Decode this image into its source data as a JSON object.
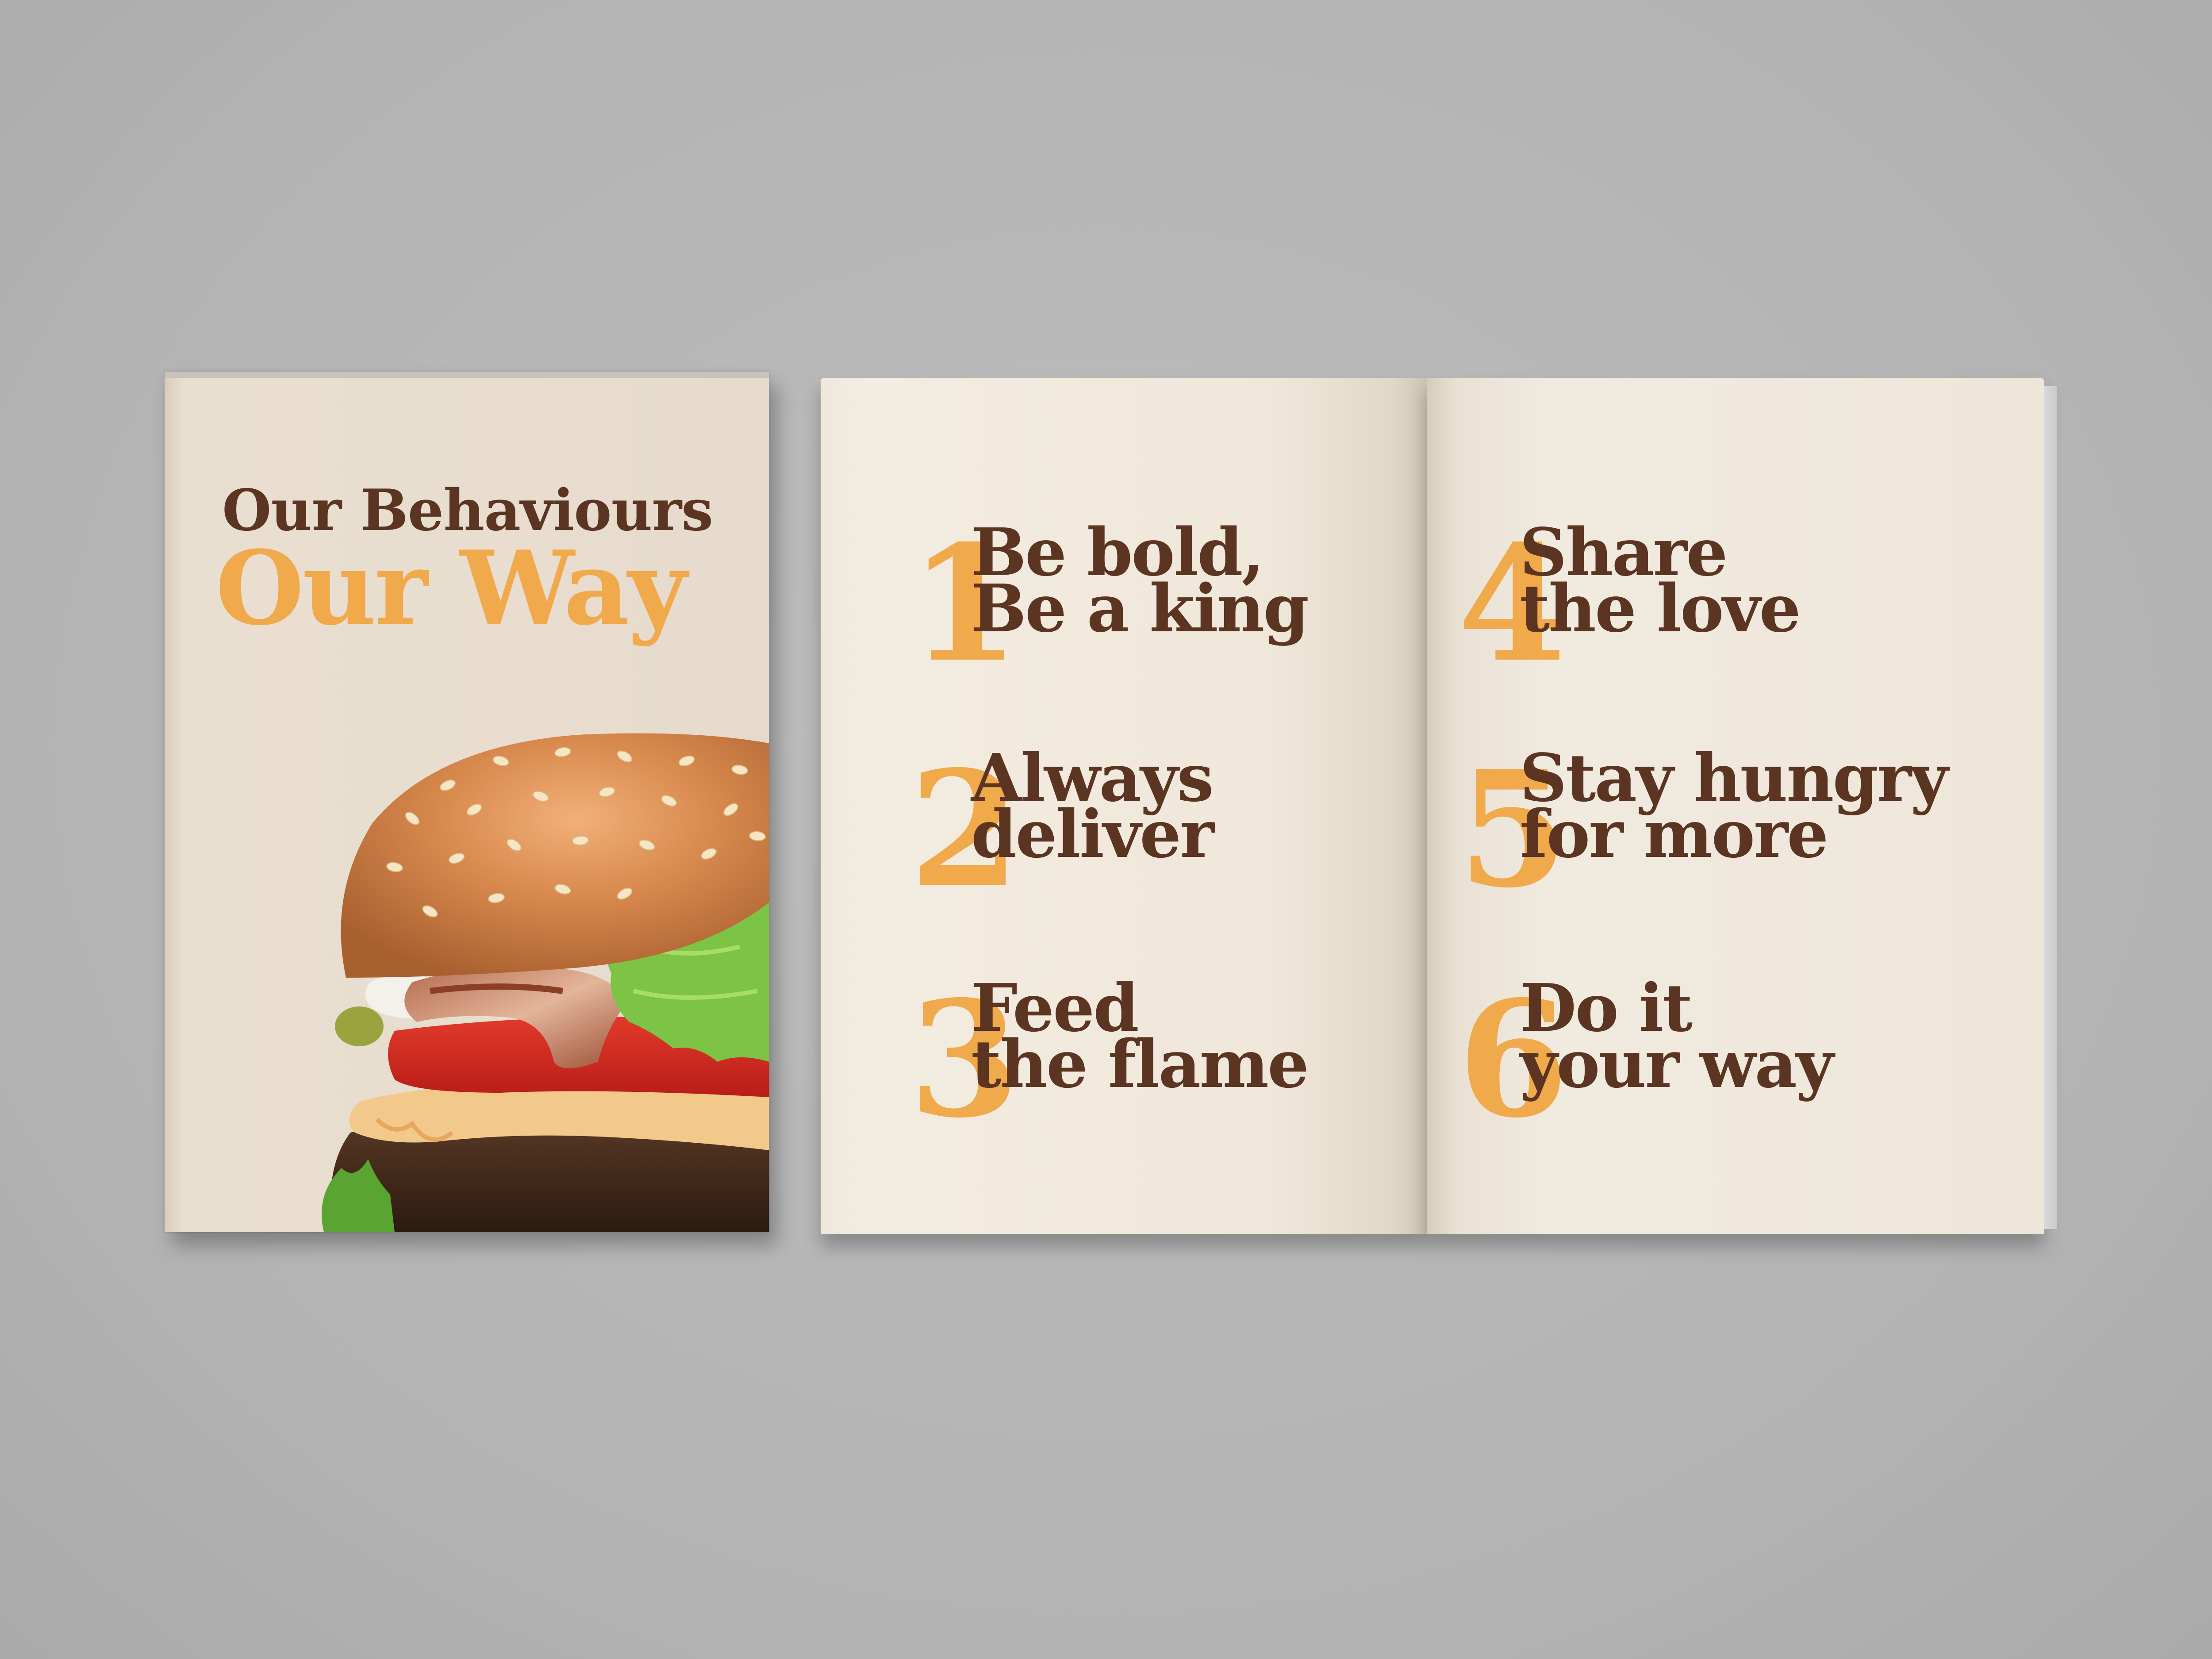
{
  "cover": {
    "title_line1": "Our Behaviours",
    "title_line2": "Our Way"
  },
  "behaviours": [
    {
      "number": "1",
      "line1": "Be bold,",
      "line2": "Be a king"
    },
    {
      "number": "2",
      "line1": "Always",
      "line2": "deliver"
    },
    {
      "number": "3",
      "line1": "Feed",
      "line2": "the flame"
    },
    {
      "number": "4",
      "line1": "Share",
      "line2": "the love"
    },
    {
      "number": "5",
      "line1": "Stay hungry",
      "line2": "for more"
    },
    {
      "number": "6",
      "line1": "Do it",
      "line2": "your way"
    }
  ],
  "colors": {
    "brown": "#5b3522",
    "orange": "#f0a94b",
    "paper": "#efe7da",
    "background": "#b5b5b5"
  }
}
